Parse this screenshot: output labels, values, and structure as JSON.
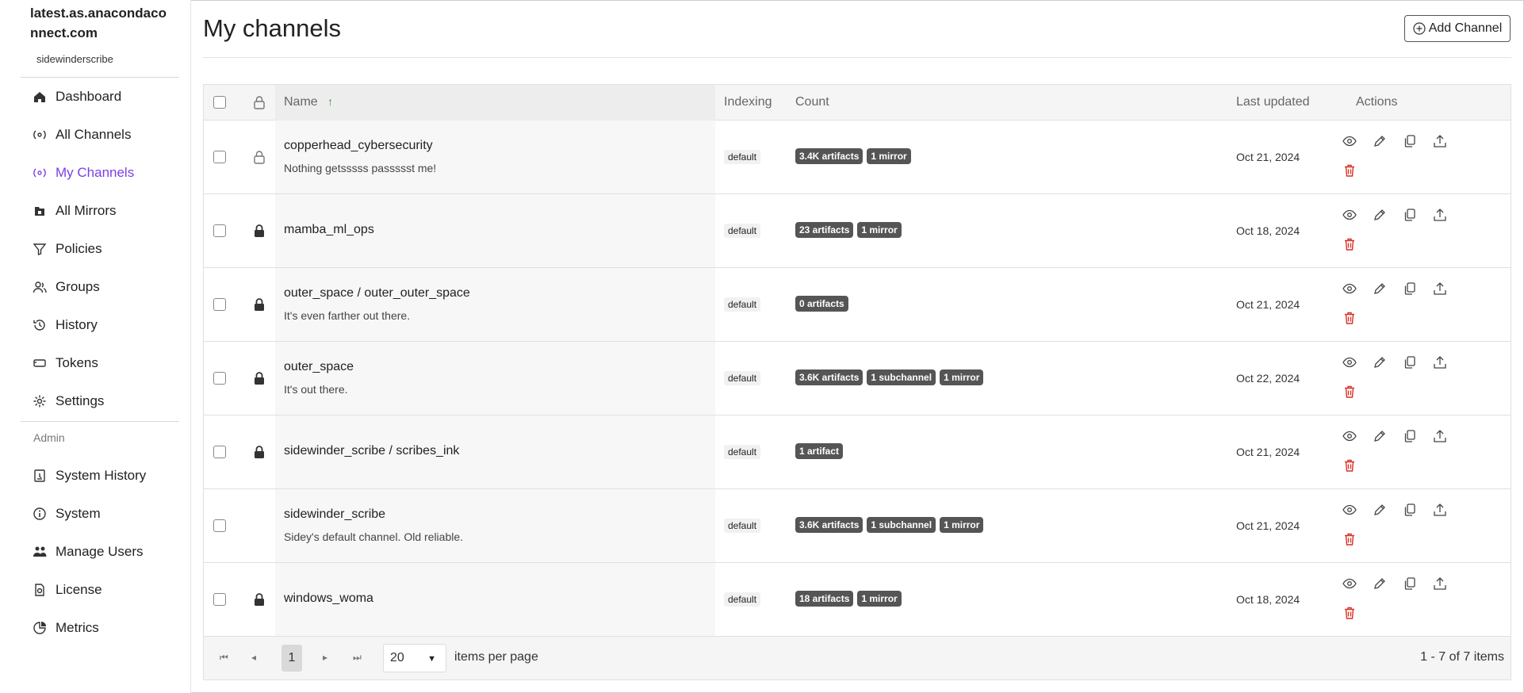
{
  "sidebar": {
    "brand": "latest.as.anacondaconnect.com",
    "username": "sidewinderscribe",
    "items": [
      {
        "label": "Dashboard",
        "icon": "home-icon"
      },
      {
        "label": "All Channels",
        "icon": "channels-icon"
      },
      {
        "label": "My Channels",
        "icon": "channels-icon",
        "active": true
      },
      {
        "label": "All Mirrors",
        "icon": "mirror-icon"
      },
      {
        "label": "Policies",
        "icon": "filter-icon"
      },
      {
        "label": "Groups",
        "icon": "groups-icon"
      },
      {
        "label": "History",
        "icon": "history-icon"
      },
      {
        "label": "Tokens",
        "icon": "token-icon"
      },
      {
        "label": "Settings",
        "icon": "gear-icon"
      }
    ],
    "admin_label": "Admin",
    "admin_items": [
      {
        "label": "System History",
        "icon": "system-history-icon"
      },
      {
        "label": "System",
        "icon": "info-icon"
      },
      {
        "label": "Manage Users",
        "icon": "users-icon"
      },
      {
        "label": "License",
        "icon": "license-icon"
      },
      {
        "label": "Metrics",
        "icon": "pie-chart-icon"
      }
    ]
  },
  "page": {
    "title": "My channels",
    "add_button": "Add Channel"
  },
  "table": {
    "headers": {
      "name": "Name",
      "indexing": "Indexing",
      "count": "Count",
      "last_updated": "Last updated",
      "actions": "Actions"
    },
    "sort_indicator": "↑",
    "rows": [
      {
        "name": "copperhead_cybersecurity",
        "description": "Nothing getsssss passssst me!",
        "indexing": "default",
        "badges": [
          "3.4K artifacts",
          "1 mirror"
        ],
        "updated": "Oct 21, 2024",
        "locked": false
      },
      {
        "name": "mamba_ml_ops",
        "description": "",
        "indexing": "default",
        "badges": [
          "23 artifacts",
          "1 mirror"
        ],
        "updated": "Oct 18, 2024",
        "locked": true
      },
      {
        "name": "outer_space / outer_outer_space",
        "description": "It's even farther out there.",
        "indexing": "default",
        "badges": [
          "0 artifacts"
        ],
        "updated": "Oct 21, 2024",
        "locked": true
      },
      {
        "name": "outer_space",
        "description": "It's out there.",
        "indexing": "default",
        "badges": [
          "3.6K artifacts",
          "1 subchannel",
          "1 mirror"
        ],
        "updated": "Oct 22, 2024",
        "locked": true
      },
      {
        "name": "sidewinder_scribe / scribes_ink",
        "description": "",
        "indexing": "default",
        "badges": [
          "1 artifact"
        ],
        "updated": "Oct 21, 2024",
        "locked": true
      },
      {
        "name": "sidewinder_scribe",
        "description": "Sidey's default channel. Old reliable.",
        "indexing": "default",
        "badges": [
          "3.6K artifacts",
          "1 subchannel",
          "1 mirror"
        ],
        "updated": "Oct 21, 2024",
        "locked": null
      },
      {
        "name": "windows_woma",
        "description": "",
        "indexing": "default",
        "badges": [
          "18 artifacts",
          "1 mirror"
        ],
        "updated": "Oct 18, 2024",
        "locked": true
      }
    ]
  },
  "pagination": {
    "current_page": "1",
    "per_page": "20",
    "per_page_label": "items per page",
    "summary": "1 - 7 of 7 items"
  },
  "colors": {
    "accent": "#7b3fe4",
    "badge": "#555555",
    "delete": "#d93025",
    "sort_arrow": "#2ca02c"
  }
}
